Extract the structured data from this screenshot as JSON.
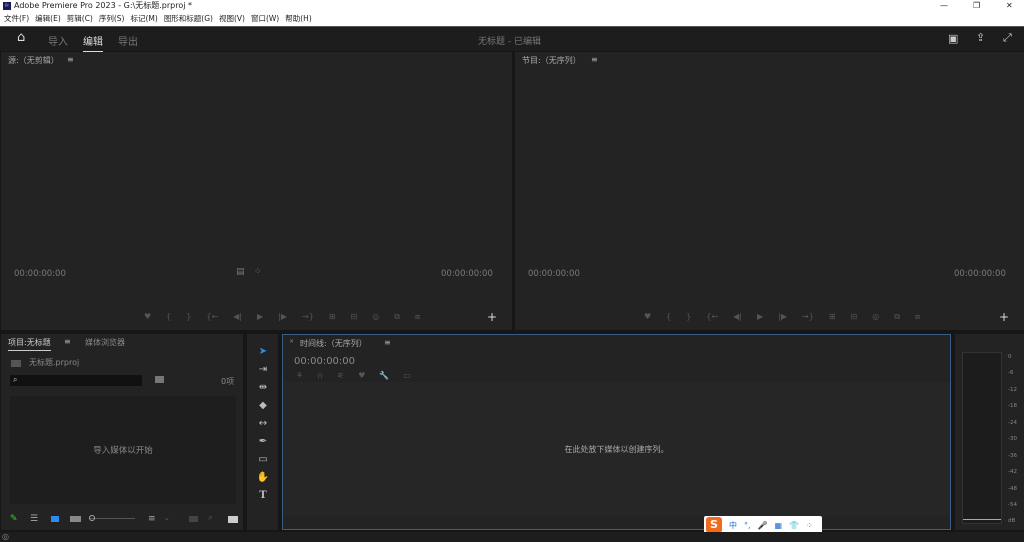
{
  "window": {
    "title": "Adobe Premiere Pro 2023 - G:\\无标题.prproj *",
    "app_icon": "Pr",
    "controls": [
      "—",
      "❐",
      "✕"
    ]
  },
  "menu": [
    "文件(F)",
    "编辑(E)",
    "剪辑(C)",
    "序列(S)",
    "标记(M)",
    "图形和标题(G)",
    "视图(V)",
    "窗口(W)",
    "帮助(H)"
  ],
  "header": {
    "tabs": [
      "导入",
      "编辑",
      "导出"
    ],
    "active": "编辑",
    "project_status": "无标题 - 已编辑"
  },
  "source": {
    "title": "源:（无剪辑）",
    "menu": "≡",
    "tc_left": "00:00:00:00",
    "tc_right": "00:00:00:00"
  },
  "program": {
    "title": "节目:（无序列）",
    "menu": "≡",
    "tc_left": "00:00:00:00",
    "tc_right": "00:00:00:00"
  },
  "controls": [
    "♥",
    "{",
    "}",
    "{←",
    "◀|",
    "▶",
    "|▶",
    "→}",
    "⊞",
    "⊟",
    "◎",
    "⧉",
    "⧈"
  ],
  "project": {
    "tab_active": "项目:无标题",
    "menu": "≡",
    "tab2": "媒体浏览器",
    "file": "无标题.prproj",
    "count": "0项",
    "empty": "导入媒体以开始"
  },
  "timeline": {
    "title": "时间线:（无序列）",
    "menu": "≡",
    "tc": "00:00:00:00",
    "empty": "在此处放下媒体以创建序列。"
  },
  "meter": {
    "labels": [
      "0",
      "-6",
      "-12",
      "-18",
      "-24",
      "-30",
      "-36",
      "-42",
      "-48",
      "-54",
      "dB"
    ]
  },
  "ime": {
    "logo": "S",
    "items": [
      "中",
      "°,",
      "🎤",
      "▦",
      "👕",
      "⁘"
    ]
  },
  "colors": {
    "accent": "#2d8ceb",
    "timeline_border": "#3a5f87"
  }
}
